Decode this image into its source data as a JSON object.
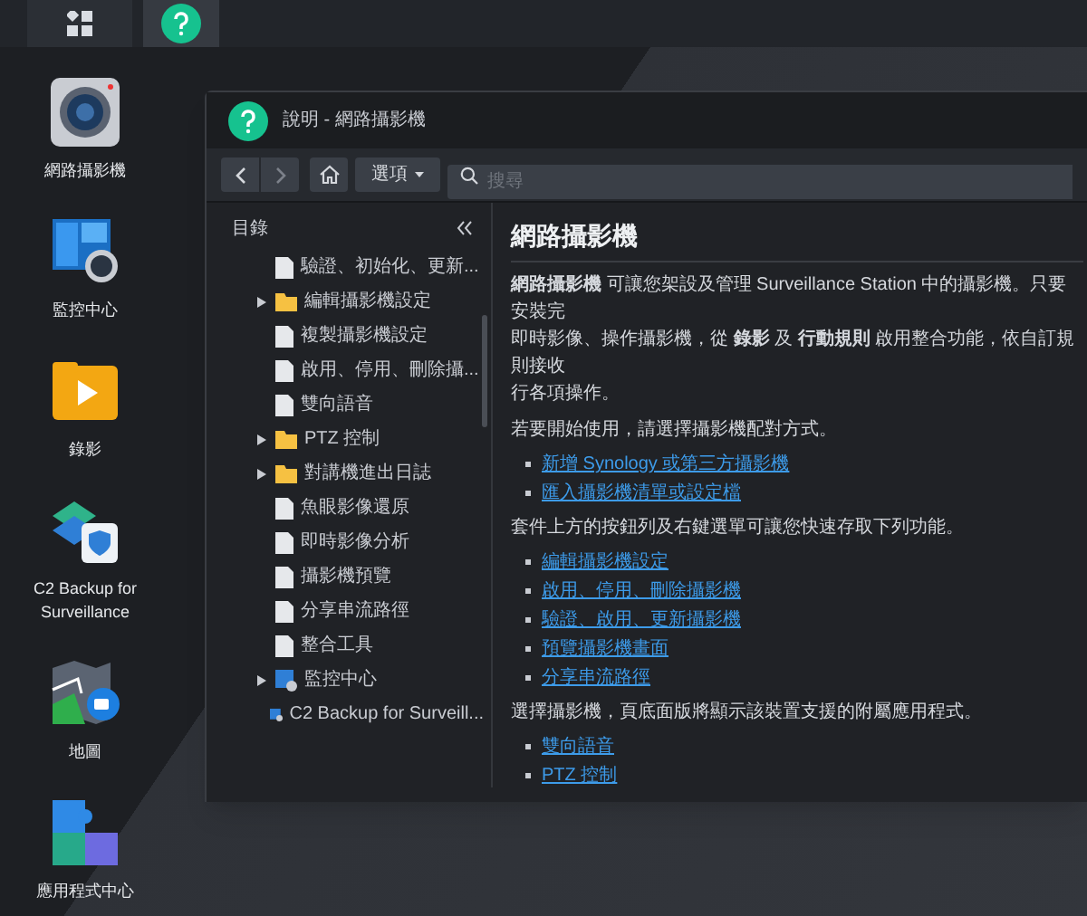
{
  "taskbar": {
    "buttons": [
      {
        "kind": "apps",
        "selected": false
      },
      {
        "kind": "help",
        "selected": true
      }
    ]
  },
  "desktop_icons": [
    {
      "kind": "camera",
      "label": "網路攝影機"
    },
    {
      "kind": "monitor",
      "label": "監控中心"
    },
    {
      "kind": "recording",
      "label": "錄影"
    },
    {
      "kind": "backup",
      "label": "C2 Backup for Surveillance"
    },
    {
      "kind": "map",
      "label": "地圖"
    },
    {
      "kind": "puzzle",
      "label": "應用程式中心"
    }
  ],
  "window": {
    "title": "說明 - 網路攝影機",
    "toolbar": {
      "options": "選項",
      "search_placeholder": "搜尋"
    },
    "sidebar": {
      "title": "目錄",
      "tree": [
        {
          "children": [
            {
              "kind": "page",
              "label": "驗證、初始化、更新..."
            },
            {
              "kind": "folder",
              "label": "編輯攝影機設定",
              "expanded": false
            },
            {
              "kind": "page",
              "label": "複製攝影機設定"
            },
            {
              "kind": "page",
              "label": "啟用、停用、刪除攝..."
            },
            {
              "kind": "page",
              "label": "雙向語音"
            },
            {
              "kind": "folder",
              "label": "PTZ 控制",
              "expanded": false
            },
            {
              "kind": "folder",
              "label": "對講機進出日誌",
              "expanded": false
            },
            {
              "kind": "page",
              "label": "魚眼影像還原"
            },
            {
              "kind": "page",
              "label": "即時影像分析"
            },
            {
              "kind": "page",
              "label": "攝影機預覽"
            },
            {
              "kind": "page",
              "label": "分享串流路徑"
            },
            {
              "kind": "page",
              "label": "整合工具"
            }
          ]
        },
        {
          "kind": "app",
          "label": "監控中心",
          "expanded": false
        },
        {
          "kind": "app",
          "label": "C2 Backup for Surveill..."
        }
      ]
    },
    "content": {
      "heading": "網路攝影機",
      "blocks": [
        {
          "kind": "paragraph",
          "lines": [
            "**網路攝影機** 可讓您架設及管理 Surveillance Station 中的攝影機。只要安裝完",
            "即時影像、操作攝影機，從 **錄影** 及 **行動規則** 啟用整合功能，依自訂規則接收",
            "行各項操作。"
          ]
        },
        {
          "kind": "paragraph",
          "lines": [
            "若要開始使用，請選擇攝影機配對方式。"
          ]
        },
        {
          "kind": "links",
          "items": [
            "新增 Synology 或第三方攝影機",
            "匯入攝影機清單或設定檔"
          ]
        },
        {
          "kind": "paragraph",
          "lines": [
            "套件上方的按鈕列及右鍵選單可讓您快速存取下列功能。"
          ]
        },
        {
          "kind": "links",
          "items": [
            "編輯攝影機設定",
            "啟用、停用、刪除攝影機",
            "驗證、啟用、更新攝影機",
            "預覽攝影機畫面",
            "分享串流路徑"
          ]
        },
        {
          "kind": "paragraph",
          "lines": [
            "選擇攝影機，頁底面版將顯示該裝置支援的附屬應用程式。"
          ]
        },
        {
          "kind": "links",
          "items": [
            "雙向語音",
            "PTZ 控制"
          ]
        }
      ]
    }
  }
}
